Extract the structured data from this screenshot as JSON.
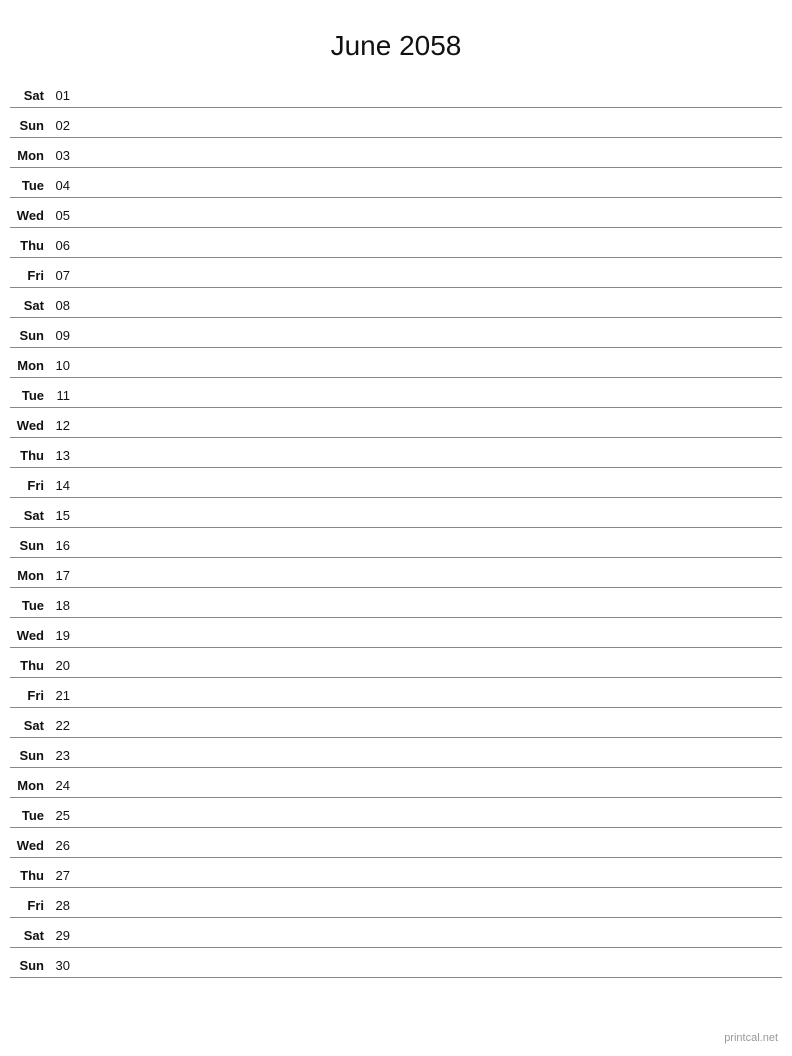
{
  "title": "June 2058",
  "watermark": "printcal.net",
  "days": [
    {
      "name": "Sat",
      "number": "01"
    },
    {
      "name": "Sun",
      "number": "02"
    },
    {
      "name": "Mon",
      "number": "03"
    },
    {
      "name": "Tue",
      "number": "04"
    },
    {
      "name": "Wed",
      "number": "05"
    },
    {
      "name": "Thu",
      "number": "06"
    },
    {
      "name": "Fri",
      "number": "07"
    },
    {
      "name": "Sat",
      "number": "08"
    },
    {
      "name": "Sun",
      "number": "09"
    },
    {
      "name": "Mon",
      "number": "10"
    },
    {
      "name": "Tue",
      "number": "11"
    },
    {
      "name": "Wed",
      "number": "12"
    },
    {
      "name": "Thu",
      "number": "13"
    },
    {
      "name": "Fri",
      "number": "14"
    },
    {
      "name": "Sat",
      "number": "15"
    },
    {
      "name": "Sun",
      "number": "16"
    },
    {
      "name": "Mon",
      "number": "17"
    },
    {
      "name": "Tue",
      "number": "18"
    },
    {
      "name": "Wed",
      "number": "19"
    },
    {
      "name": "Thu",
      "number": "20"
    },
    {
      "name": "Fri",
      "number": "21"
    },
    {
      "name": "Sat",
      "number": "22"
    },
    {
      "name": "Sun",
      "number": "23"
    },
    {
      "name": "Mon",
      "number": "24"
    },
    {
      "name": "Tue",
      "number": "25"
    },
    {
      "name": "Wed",
      "number": "26"
    },
    {
      "name": "Thu",
      "number": "27"
    },
    {
      "name": "Fri",
      "number": "28"
    },
    {
      "name": "Sat",
      "number": "29"
    },
    {
      "name": "Sun",
      "number": "30"
    }
  ]
}
